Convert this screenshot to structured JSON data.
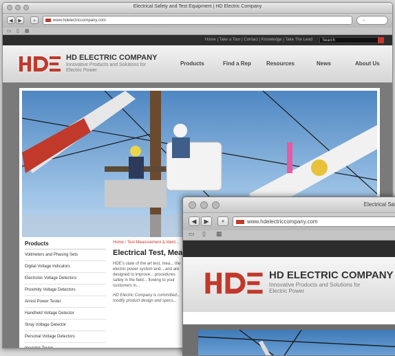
{
  "back": {
    "window_title": "Electrical Safety and Test Equipment | HD Electric Company",
    "url": "www.hdelectriccompany.com",
    "top_links": "Home | Take a Tour | Contact | Knowledge | Take The Lead",
    "search_label": "Search",
    "brand": "HD ELECTRIC COMPANY",
    "tagline": "Innovative Products and Solutions for Electric Power",
    "nav": [
      "Products",
      "Find a Rep",
      "Resources",
      "News",
      "About Us"
    ],
    "sidebar_title": "Products",
    "sidebar_items": [
      "Voltmeters and Phasing Sets",
      "Digital Voltage Indicators",
      "Electronic Voltage Detectors",
      "Proximity Voltage Detectors",
      "Arrest Power Tester",
      "Handheld Voltage Detector",
      "Stray Voltage Detector",
      "Personal Voltage Detectors",
      "Insulator Tester"
    ],
    "breadcrumb": "Home / Test Measurement & Ident...",
    "article_title": "Electrical Test, Mea",
    "article_para1": "HDE's state of the art test, mea... the electric power system and... and are designed to improve... procedures safely in the field... flowing to your customers in...",
    "article_para2": "HD Electric Company is committed... modify product design and specs..."
  },
  "front": {
    "window_title": "Electrical Safety",
    "url": "www.hdelectriccompany.com",
    "brand": "HD ELECTRIC COMPANY",
    "tagline": "Innovative Products and Solutions for Electric Power"
  },
  "logo_text": "HDE",
  "colors": {
    "brand_red": "#c0392b",
    "dark_bar": "#2d2d2d",
    "sky": "#6a9fd4"
  }
}
